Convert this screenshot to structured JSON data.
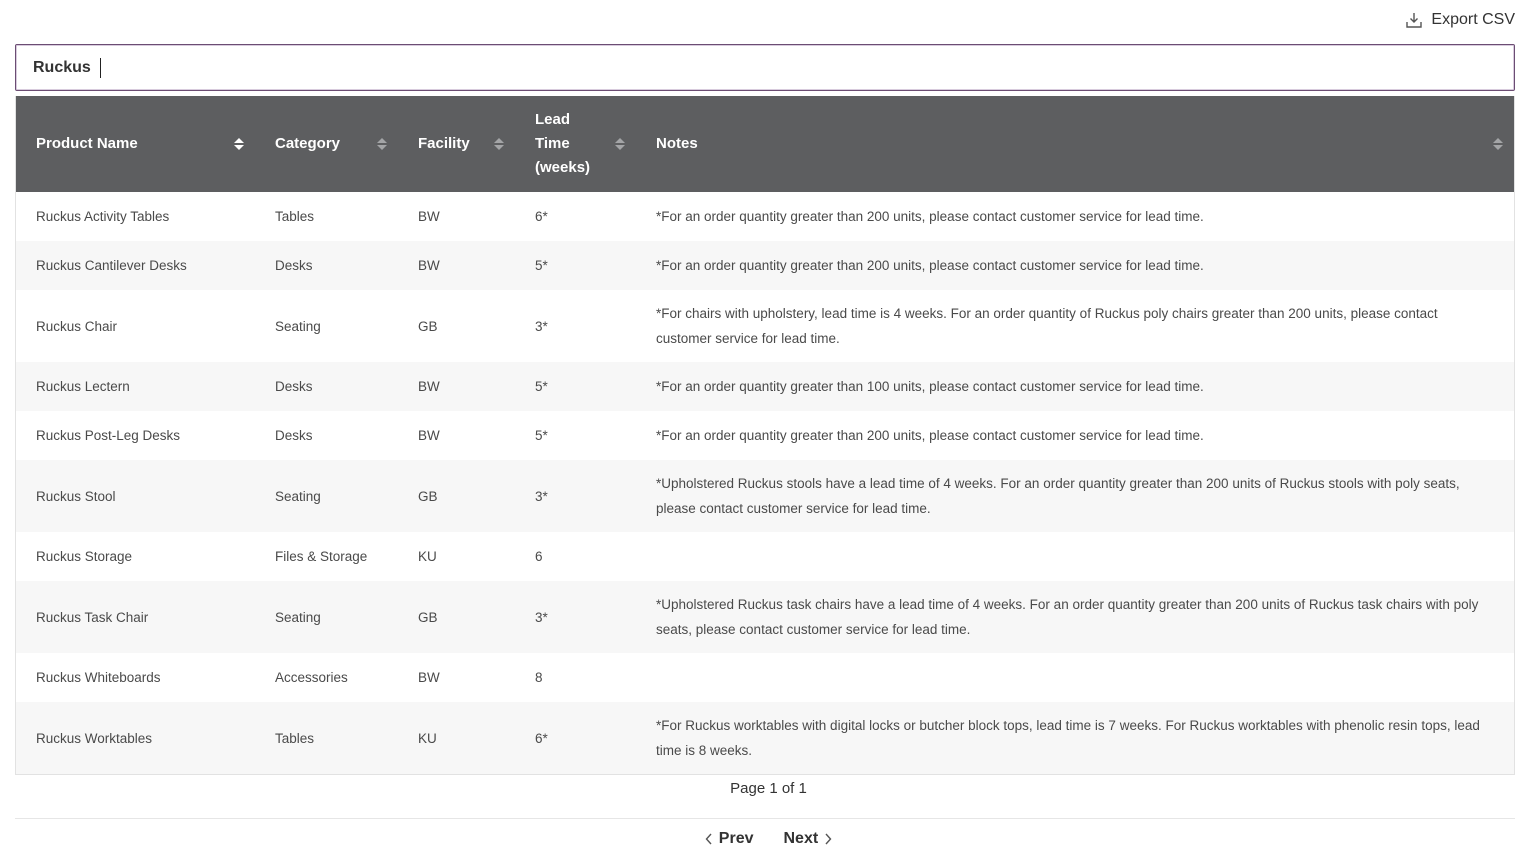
{
  "toolbar": {
    "export_label": "Export CSV"
  },
  "search": {
    "value": "Ruckus"
  },
  "table": {
    "columns": [
      {
        "label": "Product Name"
      },
      {
        "label": "Category"
      },
      {
        "label": "Facility"
      },
      {
        "label": "Lead Time (weeks)"
      },
      {
        "label": "Notes"
      }
    ],
    "rows": [
      [
        "Ruckus Activity Tables",
        "Tables",
        "BW",
        "6*",
        "*For an order quantity greater than 200 units, please contact customer service for lead time."
      ],
      [
        "Ruckus Cantilever Desks",
        "Desks",
        "BW",
        "5*",
        "*For an order quantity greater than 200 units, please contact customer service for lead time."
      ],
      [
        "Ruckus Chair",
        "Seating",
        "GB",
        "3*",
        "*For chairs with upholstery, lead time is 4 weeks. For an order quantity of Ruckus poly chairs greater than 200 units, please contact customer service for lead time."
      ],
      [
        "Ruckus Lectern",
        "Desks",
        "BW",
        "5*",
        "*For an order quantity greater than 100 units, please contact customer service for lead time."
      ],
      [
        "Ruckus Post-Leg Desks",
        "Desks",
        "BW",
        "5*",
        "*For an order quantity greater than 200 units, please contact customer service for lead time."
      ],
      [
        "Ruckus Stool",
        "Seating",
        "GB",
        "3*",
        "*Upholstered Ruckus stools have a lead time of 4 weeks. For an order quantity greater than 200 units of Ruckus stools with poly seats, please contact customer service for lead time."
      ],
      [
        "Ruckus Storage",
        "Files & Storage",
        "KU",
        "6",
        ""
      ],
      [
        "Ruckus Task Chair",
        "Seating",
        "GB",
        "3*",
        "*Upholstered Ruckus task chairs have a lead time of 4 weeks. For an order quantity greater than 200 units of Ruckus task chairs with poly seats, please contact customer service for lead time."
      ],
      [
        "Ruckus Whiteboards",
        "Accessories",
        "BW",
        "8",
        ""
      ],
      [
        "Ruckus Worktables",
        "Tables",
        "KU",
        "6*",
        "*For Ruckus worktables with digital locks or butcher block tops, lead time is 7 weeks. For Ruckus worktables with phenolic resin tops, lead time is 8 weeks."
      ]
    ]
  },
  "pagination": {
    "page_info": "Page 1 of 1",
    "prev_label": "Prev",
    "next_label": "Next"
  },
  "icons": {
    "export": "download-icon",
    "sort": "sort-icon",
    "prev": "chevron-left-icon",
    "next": "chevron-right-icon"
  }
}
